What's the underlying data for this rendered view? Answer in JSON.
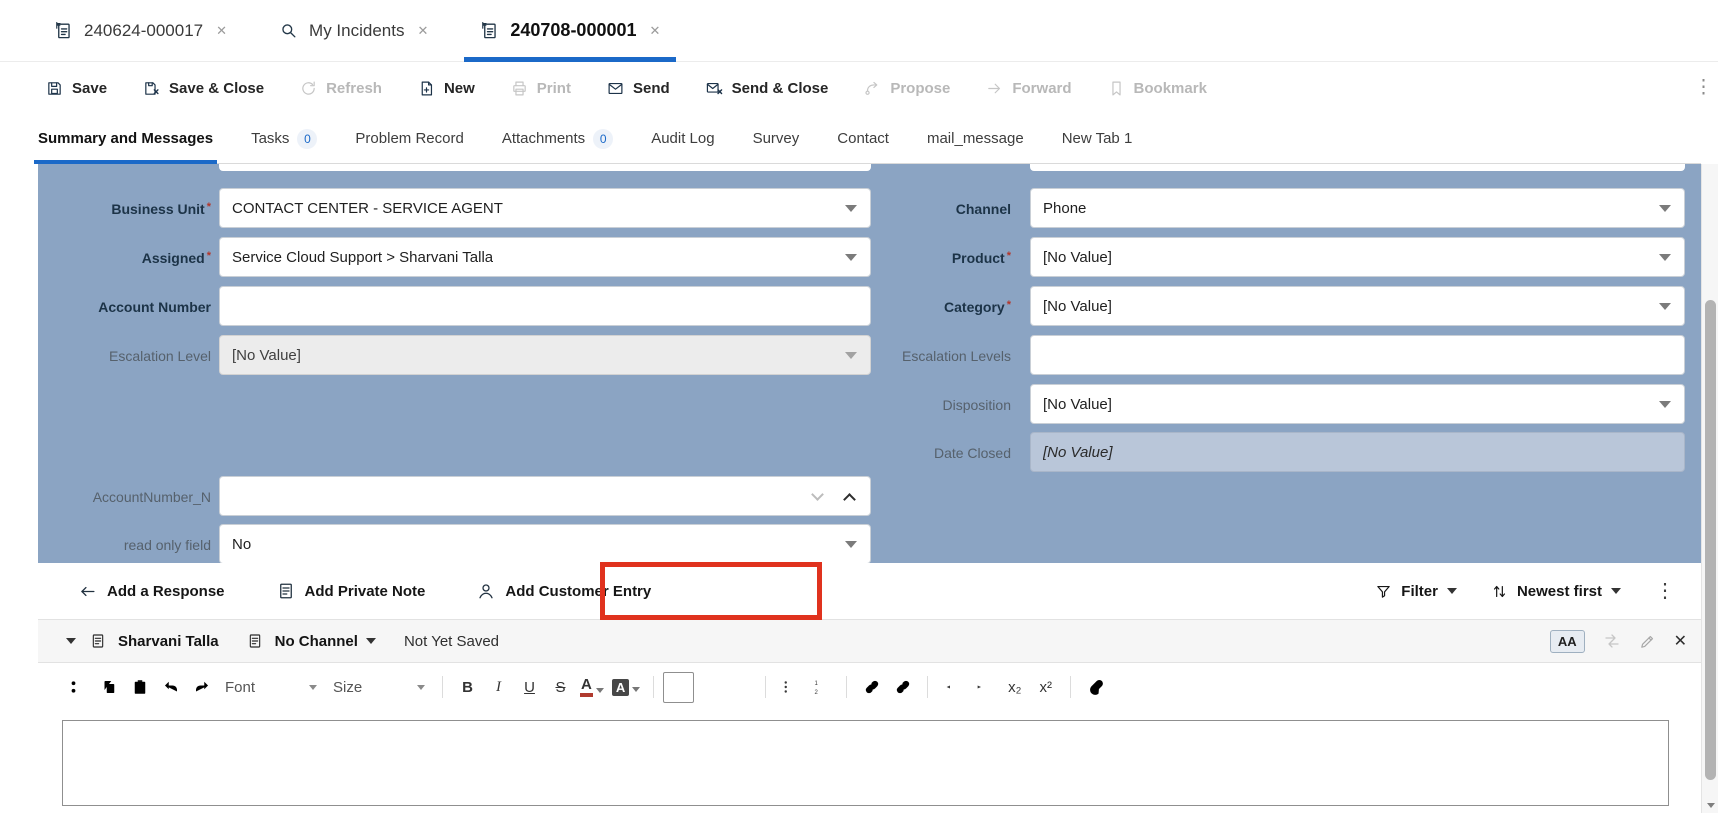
{
  "colors": {
    "form_background": "#8ba4c3",
    "active_tab_accent": "#1b69c8",
    "required_marker": "#b3362b",
    "highlight_box": "#e0321e",
    "readonly_field_background": "#b9c6d9"
  },
  "icons": {
    "incident-icon": "page-with-flag",
    "search-icon": "magnifier",
    "close-icon": "✕",
    "save-icon": "floppy-disk",
    "save-close-icon": "floppy-disk-x",
    "refresh-icon": "circular-arrow",
    "new-icon": "page-plus",
    "print-icon": "printer",
    "send-icon": "envelope",
    "send-close-icon": "envelope-x",
    "propose-icon": "curved-branch-arrow",
    "forward-icon": "arrow-right",
    "bookmark-icon": "ribbon",
    "arrow-left-icon": "←",
    "note-icon": "document-lines",
    "person-icon": "user-silhouette",
    "filter-icon": "funnel",
    "sort-icon": "up-down-arrows",
    "overflow-icon": "⋮",
    "chevron-down-icon": "▾",
    "chevron-up-icon": "︿",
    "document-icon": "document",
    "font-size-icon": "AA",
    "translate-icon": "swap-arrows",
    "pencil-icon": "pencil",
    "cut-icon": "scissors",
    "copy-icon": "two-pages",
    "paste-icon": "clipboard",
    "undo-icon": "curved-left-arrow",
    "redo-icon": "curved-right-arrow",
    "text-color-icon": "A-underbar",
    "fill-color-icon": "A-box",
    "align-left-icon": "lines-left",
    "align-center-icon": "lines-center",
    "align-right-icon": "lines-right",
    "bullet-list-icon": "dots-lines",
    "numbered-list-icon": "numbers-lines",
    "link-icon": "chain",
    "unlink-icon": "chain-slash",
    "outdent-icon": "lines-arrow-left",
    "indent-icon": "lines-arrow-right",
    "attachment-icon": "paperclip"
  },
  "window_tabs": {
    "items": [
      {
        "label": "240624-000017",
        "icon": "incident-icon",
        "close": "✕",
        "active": false
      },
      {
        "label": "My Incidents",
        "icon": "search-icon",
        "close": "✕",
        "active": false
      },
      {
        "label": "240708-000001",
        "icon": "incident-icon",
        "close": "✕",
        "active": true
      }
    ]
  },
  "toolbar": {
    "overflow_icon": "⋮",
    "items": [
      {
        "label": "Save",
        "icon": "save-icon",
        "enabled": true
      },
      {
        "label": "Save & Close",
        "icon": "save-close-icon",
        "enabled": true
      },
      {
        "label": "Refresh",
        "icon": "refresh-icon",
        "enabled": false
      },
      {
        "label": "New",
        "icon": "new-icon",
        "enabled": true
      },
      {
        "label": "Print",
        "icon": "print-icon",
        "enabled": false
      },
      {
        "label": "Send",
        "icon": "send-icon",
        "enabled": true
      },
      {
        "label": "Send & Close",
        "icon": "send-close-icon",
        "enabled": true
      },
      {
        "label": "Propose",
        "icon": "propose-icon",
        "enabled": false
      },
      {
        "label": "Forward",
        "icon": "forward-icon",
        "enabled": false
      },
      {
        "label": "Bookmark",
        "icon": "bookmark-icon",
        "enabled": false
      }
    ]
  },
  "record_tabs": {
    "items": [
      {
        "label": "Summary and Messages",
        "badge": "",
        "active": true
      },
      {
        "label": "Tasks",
        "badge": "0",
        "active": false
      },
      {
        "label": "Problem Record",
        "badge": "",
        "active": false
      },
      {
        "label": "Attachments",
        "badge": "0",
        "active": false
      },
      {
        "label": "Audit Log",
        "badge": "",
        "active": false
      },
      {
        "label": "Survey",
        "badge": "",
        "active": false
      },
      {
        "label": "Contact",
        "badge": "",
        "active": false
      },
      {
        "label": "mail_message",
        "badge": "",
        "active": false
      },
      {
        "label": "New Tab 1",
        "badge": "",
        "active": false
      }
    ]
  },
  "form": {
    "left_fields": [
      {
        "label": "Business Unit",
        "required": "*",
        "value": "CONTACT CENTER - SERVICE AGENT",
        "control": "select",
        "state": "enabled"
      },
      {
        "label": "Assigned",
        "required": "*",
        "value": "Service Cloud Support > Sharvani Talla",
        "control": "select",
        "state": "enabled"
      },
      {
        "label": "Account Number",
        "required": "",
        "value": "",
        "control": "text",
        "state": "enabled"
      },
      {
        "label": "Escalation Level",
        "required": "",
        "value": "[No Value]",
        "control": "select",
        "state": "disabled"
      },
      {
        "label": "AccountNumber_N",
        "required": "",
        "value": "",
        "control": "combo-expanded",
        "state": "enabled"
      },
      {
        "label": "read only field",
        "required": "",
        "value": "No",
        "control": "select",
        "state": "enabled"
      }
    ],
    "right_fields": [
      {
        "label": "Channel",
        "required": "",
        "value": "Phone",
        "control": "select",
        "state": "enabled"
      },
      {
        "label": "Product",
        "required": "*",
        "value": "[No Value]",
        "control": "select",
        "state": "enabled"
      },
      {
        "label": "Category",
        "required": "*",
        "value": "[No Value]",
        "control": "select",
        "state": "enabled"
      },
      {
        "label": "Escalation Levels",
        "required": "",
        "value": "",
        "control": "text",
        "state": "enabled"
      },
      {
        "label": "Disposition",
        "required": "",
        "value": "[No Value]",
        "control": "select",
        "state": "enabled"
      },
      {
        "label": "Date Closed",
        "required": "",
        "value": "[No Value]",
        "control": "readonly",
        "state": "readonly"
      }
    ]
  },
  "messages": {
    "actions": [
      {
        "label": "Add a Response",
        "icon": "arrow-left-icon"
      },
      {
        "label": "Add Private Note",
        "icon": "note-icon"
      },
      {
        "label": "Add Customer Entry",
        "icon": "person-icon"
      }
    ],
    "filter": {
      "label": "Filter"
    },
    "sort": {
      "label": "Newest first"
    },
    "overflow_icon": "⋮"
  },
  "editor": {
    "header": {
      "author": "Sharvani Talla",
      "channel": "No Channel",
      "status": "Not Yet Saved",
      "font_size_button": "AA",
      "close_label": "✕"
    },
    "toolbar": {
      "font_label": "Font",
      "size_label": "Size",
      "bold": "B",
      "italic": "I",
      "underline": "U",
      "strike": "S",
      "text_color": "A",
      "fill_color": "A",
      "subscript": "x₂",
      "superscript": "x²"
    },
    "body_text": ""
  }
}
